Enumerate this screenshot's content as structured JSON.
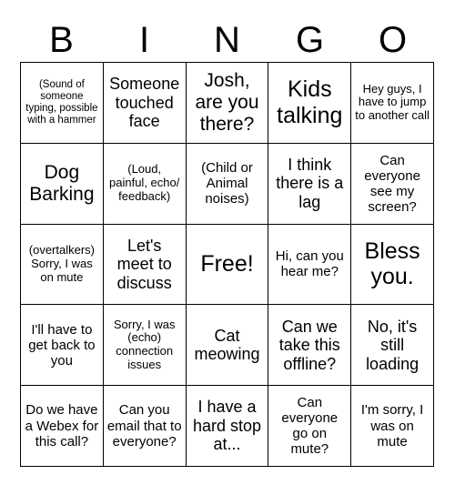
{
  "title": "Virtual Meeting Bingo Card",
  "header": {
    "letters": [
      "B",
      "I",
      "N",
      "G",
      "O"
    ]
  },
  "colors": {
    "background": "#ffffff",
    "border": "#000000",
    "text": "#000000"
  },
  "grid": {
    "columns": 5,
    "rows": 5,
    "rows_data": [
      [
        {
          "text": "(Sound of someone typing, possible with a hammer",
          "size": "xs"
        },
        {
          "text": "Someone touched face",
          "size": "lg"
        },
        {
          "text": "Josh, are you there?",
          "size": "xl"
        },
        {
          "text": "Kids talking",
          "size": "xxl"
        },
        {
          "text": "Hey guys, I have to jump to another call",
          "size": "sm"
        }
      ],
      [
        {
          "text": "Dog Barking",
          "size": "xl"
        },
        {
          "text": "(Loud, painful, echo/ feedback)",
          "size": "sm"
        },
        {
          "text": "(Child or Animal noises)",
          "size": "md"
        },
        {
          "text": "I think there is a lag",
          "size": "lg"
        },
        {
          "text": "Can everyone see my screen?",
          "size": "md"
        }
      ],
      [
        {
          "text": "(overtalkers) Sorry, I was on mute",
          "size": "sm"
        },
        {
          "text": "Let's meet to discuss",
          "size": "lg"
        },
        {
          "text": "Free!",
          "size": "xxl"
        },
        {
          "text": "Hi, can you hear me?",
          "size": "md"
        },
        {
          "text": "Bless you.",
          "size": "xxl"
        }
      ],
      [
        {
          "text": "I'll have to get back to you",
          "size": "md"
        },
        {
          "text": "Sorry, I was (echo) connection issues",
          "size": "sm"
        },
        {
          "text": "Cat meowing",
          "size": "lg"
        },
        {
          "text": "Can we take this offline?",
          "size": "lg"
        },
        {
          "text": "No, it's still loading",
          "size": "lg"
        }
      ],
      [
        {
          "text": "Do we have a Webex for this call?",
          "size": "md"
        },
        {
          "text": "Can you email that to everyone?",
          "size": "md"
        },
        {
          "text": "I have a hard stop at...",
          "size": "lg"
        },
        {
          "text": "Can everyone go on mute?",
          "size": "md"
        },
        {
          "text": "I'm sorry, I was on mute",
          "size": "md"
        }
      ]
    ]
  }
}
